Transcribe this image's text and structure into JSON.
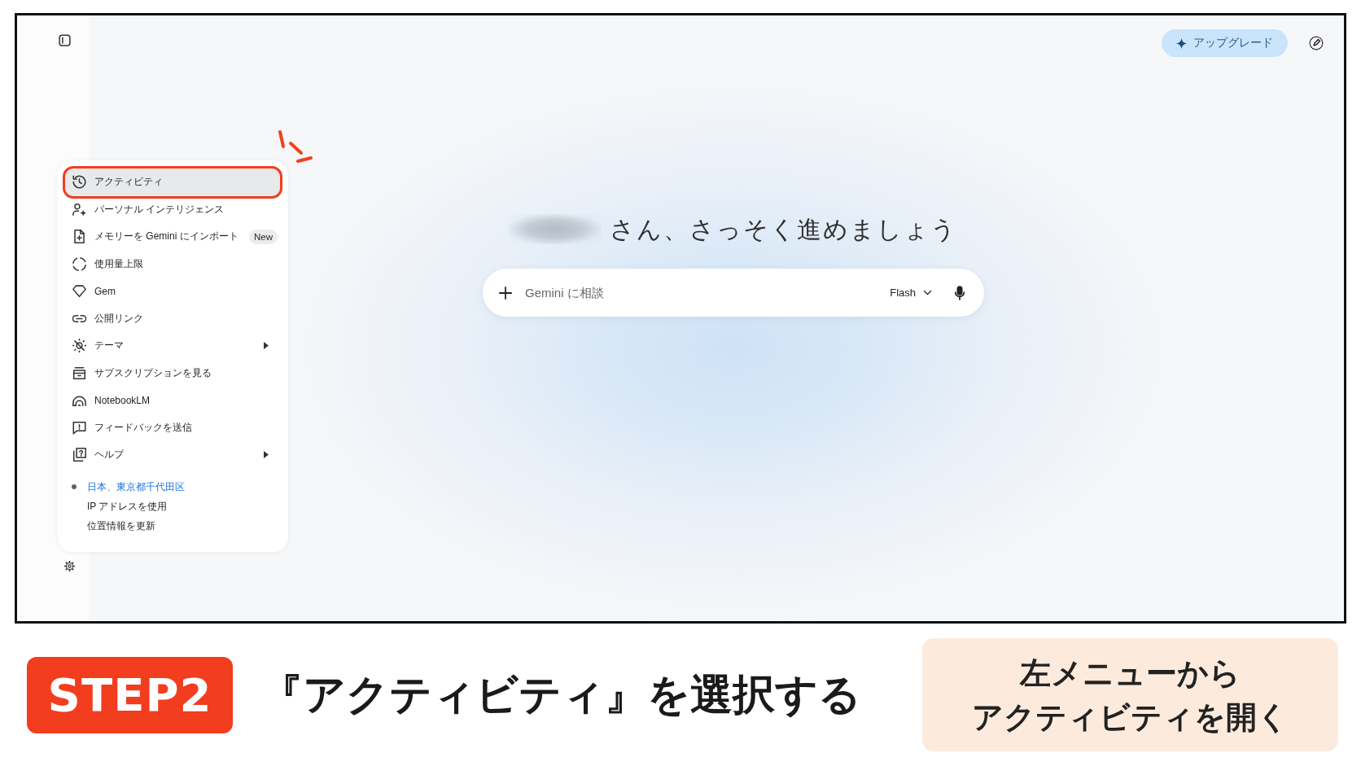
{
  "header": {
    "upgrade_button": "アップグレード"
  },
  "menu": {
    "items": [
      {
        "label": "アクティビティ",
        "selected": true,
        "highlighted": true,
        "submenu": false
      },
      {
        "label": "パーソナル インテリジェンス",
        "selected": false,
        "highlighted": false,
        "submenu": false
      },
      {
        "label": "メモリーを Gemini にインポート",
        "selected": false,
        "highlighted": false,
        "submenu": false,
        "badge": "New"
      },
      {
        "label": "使用量上限",
        "selected": false,
        "highlighted": false,
        "submenu": false
      },
      {
        "label": "Gem",
        "selected": false,
        "highlighted": false,
        "submenu": false
      },
      {
        "label": "公開リンク",
        "selected": false,
        "highlighted": false,
        "submenu": false
      },
      {
        "label": "テーマ",
        "selected": false,
        "highlighted": false,
        "submenu": true
      },
      {
        "label": "サブスクリプションを見る",
        "selected": false,
        "highlighted": false,
        "submenu": false
      },
      {
        "label": "NotebookLM",
        "selected": false,
        "highlighted": false,
        "submenu": false
      },
      {
        "label": "フィードバックを送信",
        "selected": false,
        "highlighted": false,
        "submenu": false
      },
      {
        "label": "ヘルプ",
        "selected": false,
        "highlighted": false,
        "submenu": true
      }
    ],
    "location": {
      "place": "日本、東京都千代田区",
      "source": "IP アドレスを使用",
      "update_link": "位置情報を更新"
    }
  },
  "greeting": "さん、さっそく進めましょう",
  "prompt": {
    "placeholder": "Gemini に相談",
    "model": "Flash"
  },
  "caption": {
    "step": "STEP2",
    "title": "『アクティビティ』を選択する",
    "note": [
      "左メニューから",
      "アクティビティを開く"
    ]
  }
}
